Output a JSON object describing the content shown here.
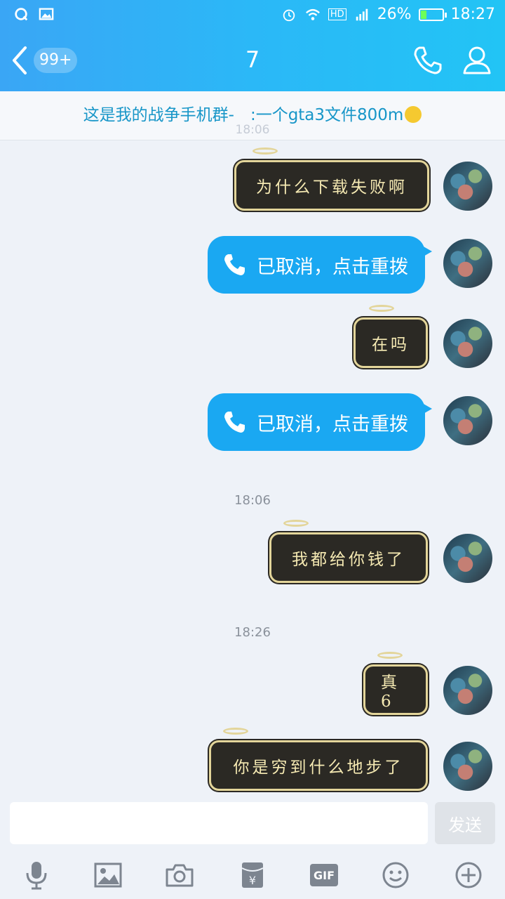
{
  "status_bar": {
    "battery_percent": "26%",
    "time": "18:27",
    "network": "HD",
    "battery_level": 0.26
  },
  "header": {
    "back_label": "",
    "unread_count": "99+",
    "title": "7"
  },
  "notice": {
    "text": "这是我的战争手机群-　:一个gta3文件800m",
    "ghost_time": "18:06"
  },
  "messages": [
    {
      "type": "text",
      "text": "为什么下载失败啊"
    },
    {
      "type": "call",
      "text": "已取消，点击重拨"
    },
    {
      "type": "text",
      "text": "在吗"
    },
    {
      "type": "call",
      "text": "已取消，点击重拨"
    },
    {
      "type": "timestamp",
      "text": "18:06"
    },
    {
      "type": "text",
      "text": "我都给你钱了"
    },
    {
      "type": "timestamp",
      "text": "18:26"
    },
    {
      "type": "text",
      "text": "真6"
    },
    {
      "type": "text",
      "text": "你是穷到什么地步了"
    }
  ],
  "composer": {
    "placeholder": "",
    "send_label": "发送",
    "gif_label": "GIF"
  },
  "toolbar_icons": [
    "microphone-icon",
    "image-icon",
    "camera-icon",
    "red-packet-icon",
    "gif-icon",
    "emoji-icon",
    "plus-icon"
  ],
  "colors": {
    "header_start": "#3aa6f5",
    "header_end": "#22c4f5",
    "call_bubble": "#1aa8f2",
    "angel_bubble_fill": "#2b2924",
    "angel_bubble_text": "#f6eab3",
    "angel_bubble_border": "#e3d59a",
    "notice_text": "#1896c8"
  }
}
